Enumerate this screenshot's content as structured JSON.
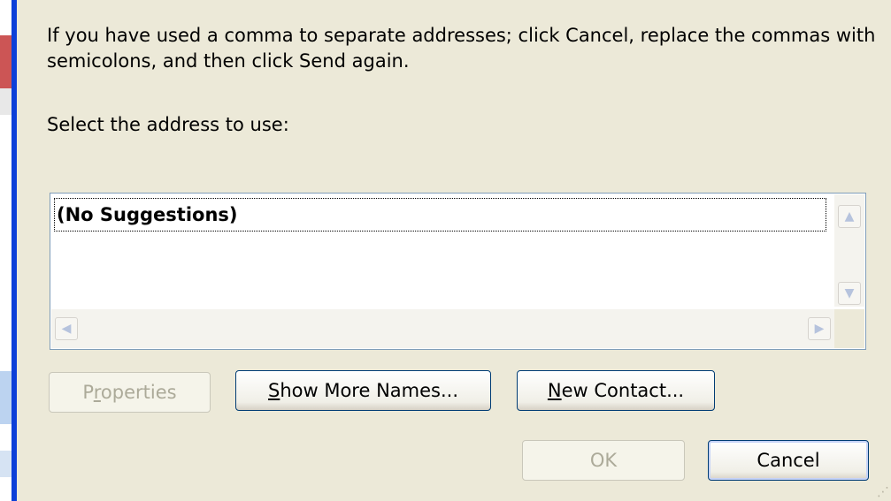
{
  "dialog": {
    "message": "If you have used a comma to separate addresses; click Cancel, replace the commas with semicolons, and then click Send again.",
    "prompt": "Select the address to use:",
    "list": {
      "items": [
        "(No Suggestions)"
      ]
    },
    "buttons": {
      "properties": {
        "label": "Properties",
        "accesskey": "r",
        "enabled": false
      },
      "show_more_names": {
        "label": "Show More Names...",
        "accesskey": "S",
        "enabled": true
      },
      "new_contact": {
        "label": "New Contact...",
        "accesskey": "N",
        "enabled": true
      },
      "ok": {
        "label": "OK",
        "enabled": false
      },
      "cancel": {
        "label": "Cancel",
        "enabled": true
      }
    }
  },
  "colors": {
    "window_frame": "#0c3fd8",
    "dialog_bg": "#ece9d8",
    "list_border": "#7f9db9"
  }
}
